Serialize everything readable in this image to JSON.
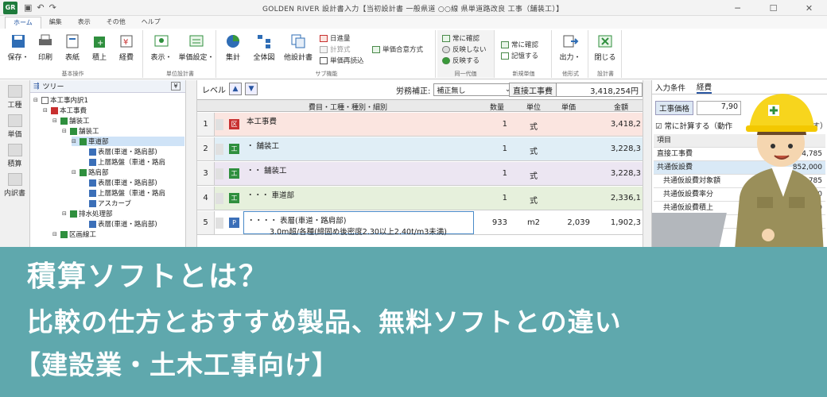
{
  "titlebar": {
    "logo": "GR",
    "title": "GOLDEN RIVER 設計書入力【当初設計書 一般県道 ○○線 県単道路改良 工事（舗装工）】",
    "controls": [
      "─",
      "☐",
      "✕"
    ]
  },
  "ribbon_tabs": [
    "ホーム",
    "編集",
    "表示",
    "その他",
    "ヘルプ"
  ],
  "ribbon": {
    "groups": [
      {
        "label": "基本操作",
        "buttons": [
          "保存・",
          "印刷",
          "表紙",
          "積上",
          "経費"
        ]
      },
      {
        "label": "単位設計書",
        "buttons": [
          "表示・",
          "単価設定・"
        ]
      },
      {
        "label": "サブ機能",
        "buttons": [
          "集計",
          "全体図",
          "他設計書"
        ],
        "small": [
          "日進量",
          "計算式",
          "単価再読込",
          "単価合意方式"
        ]
      },
      {
        "label": "同一代価",
        "small": [
          "常に確認",
          "反映しない",
          "反映する"
        ]
      },
      {
        "label": "新規単価",
        "small": [
          "常に確認",
          "記憶する"
        ]
      },
      {
        "label": "他形式",
        "buttons": [
          "出力・"
        ]
      },
      {
        "label": "設計書",
        "buttons": [
          "閉じる"
        ]
      }
    ]
  },
  "leftbar": [
    "工種",
    "単価",
    "積算",
    "内訳書"
  ],
  "tree": {
    "header": "ツリー",
    "rows": [
      {
        "indent": 0,
        "label": "本工事内訳1",
        "type": "doc",
        "tw": "⊟"
      },
      {
        "indent": 1,
        "label": "本工事費",
        "type": "red",
        "tw": "⊟"
      },
      {
        "indent": 2,
        "label": "舗装工",
        "type": "green",
        "tw": "⊟"
      },
      {
        "indent": 3,
        "label": "舗装工",
        "type": "green",
        "tw": "⊟"
      },
      {
        "indent": 4,
        "label": "車道部",
        "type": "green",
        "tw": "⊟",
        "selected": true
      },
      {
        "indent": 5,
        "label": "表層(車道・路肩部)",
        "type": "blue",
        "tw": ""
      },
      {
        "indent": 5,
        "label": "上層路盤（車道・路肩",
        "type": "blue",
        "tw": ""
      },
      {
        "indent": 4,
        "label": "路肩部",
        "type": "green",
        "tw": "⊟"
      },
      {
        "indent": 5,
        "label": "表層(車道・路肩部)",
        "type": "blue",
        "tw": ""
      },
      {
        "indent": 5,
        "label": "上層路盤（車道・路肩",
        "type": "blue",
        "tw": ""
      },
      {
        "indent": 5,
        "label": "アスカーブ",
        "type": "blue",
        "tw": ""
      },
      {
        "indent": 3,
        "label": "排水処理部",
        "type": "green",
        "tw": "⊟"
      },
      {
        "indent": 5,
        "label": "表層(車道・路肩部)",
        "type": "blue",
        "tw": ""
      },
      {
        "indent": 2,
        "label": "区画線工",
        "type": "green",
        "tw": "⊟"
      }
    ]
  },
  "center": {
    "level_label": "レベル",
    "correction_label": "労務補正:",
    "correction_value": "補正無し",
    "direct_cost_label": "直接工事費",
    "direct_cost_value": "3,418,254円",
    "headers": [
      "費目・工種・種別・細別",
      "数量",
      "単位",
      "単価",
      "金額"
    ],
    "rows": [
      {
        "no": "1",
        "icon": "区",
        "color": "red",
        "name": "本工事費",
        "sub": "",
        "qty": "1",
        "unit": "式",
        "price": "",
        "amount": "3,418,2",
        "bg": "#fbe5e0"
      },
      {
        "no": "2",
        "icon": "工",
        "color": "green",
        "name": "・ 舗装工",
        "sub": "",
        "qty": "1",
        "unit": "式",
        "price": "",
        "amount": "3,228,3",
        "bg": "#e0eef6"
      },
      {
        "no": "3",
        "icon": "工",
        "color": "green",
        "name": "・・ 舗装工",
        "sub": "",
        "qty": "1",
        "unit": "式",
        "price": "",
        "amount": "3,228,3",
        "bg": "#ece6f2"
      },
      {
        "no": "4",
        "icon": "工",
        "color": "green",
        "name": "・・・ 車道部",
        "sub": "",
        "qty": "1",
        "unit": "式",
        "price": "",
        "amount": "2,336,1",
        "bg": "#e6f0dc"
      },
      {
        "no": "5",
        "icon": "P",
        "color": "blue",
        "name": "・・・・ 表層(車道・路肩部)",
        "sub": "3.0m超/各種(締固め後密度2.30以上2.40t/m3未満)",
        "qty": "933",
        "unit": "m2",
        "price": "2,039",
        "amount": "1,902,3",
        "bg": "#ffffff"
      }
    ]
  },
  "rpanel": {
    "tabs": [
      "入力条件",
      "経費",
      "積算履歴"
    ],
    "price_label": "工事価格",
    "price_value": "7,90",
    "check_label": "常に計算する（動作",
    "check_tail": "ます）",
    "items": [
      "項目",
      "直接工事費",
      "共通仮設費",
      "共通仮設費対象額",
      "共通仮設費率分",
      "共通仮設費積上",
      "純工事費"
    ],
    "values": [
      "",
      "3,424,785",
      "852,000",
      "4,785",
      "000",
      "0",
      "35"
    ]
  },
  "banner": {
    "line1": "積算ソフトとは？",
    "line2": "比較の仕方とおすすめ製品、無料ソフトとの違い",
    "line3": "【建設業・土木工事向け】",
    "color": "#5fa8ad"
  }
}
